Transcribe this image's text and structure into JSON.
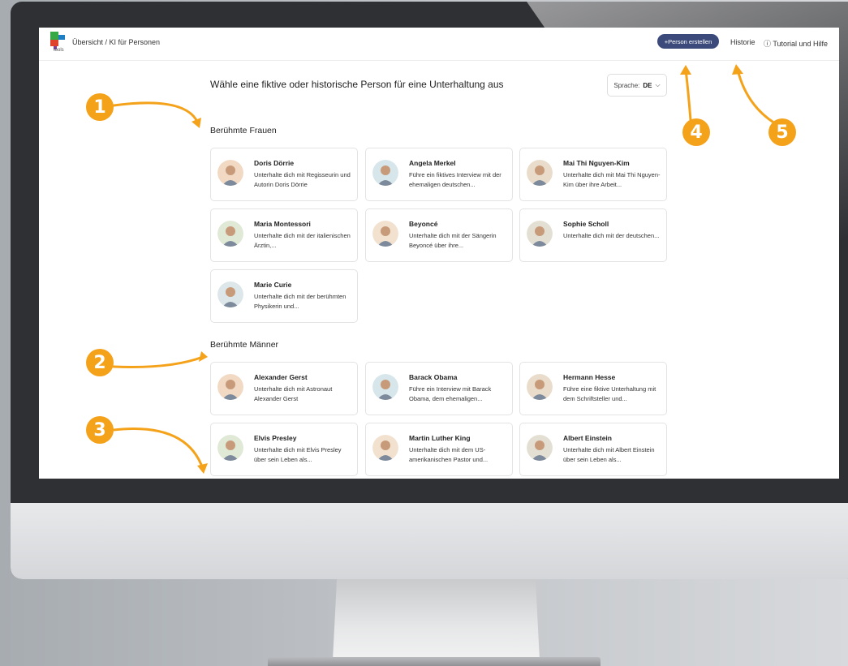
{
  "topbar": {
    "breadcrumb": "Übersicht / KI für Personen",
    "logo_text": "tools",
    "create_button": "+Person erstellen",
    "history_link": "Historie",
    "tutorial_link": "ⓘ Tutorial und Hilfe"
  },
  "main": {
    "headline": "Wähle eine fiktive oder historische Person für eine Unterhaltung aus",
    "language_label": "Sprache:",
    "language_value": "DE",
    "sections": [
      {
        "title": "Berühmte Frauen",
        "cards": [
          {
            "name": "Doris Dörrie",
            "desc": "Unterhalte dich mit Regisseurin und Autorin Doris Dörrie"
          },
          {
            "name": "Angela Merkel",
            "desc": "Führe ein fiktives Interview mit der ehemaligen deutschen..."
          },
          {
            "name": "Mai Thi Nguyen-Kim",
            "desc": "Unterhalte dich mit Mai Thi Nguyen-Kim über ihre Arbeit..."
          },
          {
            "name": "Maria Montessori",
            "desc": "Unterhalte dich mit der italienischen Ärztin,..."
          },
          {
            "name": "Beyoncé",
            "desc": "Unterhalte dich mit der Sängerin Beyoncé über ihre..."
          },
          {
            "name": "Sophie Scholl",
            "desc": "Unterhalte dich mit der deutschen..."
          },
          {
            "name": "Marie Curie",
            "desc": "Unterhalte dich mit der berühmten Physikerin und..."
          }
        ]
      },
      {
        "title": "Berühmte Männer",
        "cards": [
          {
            "name": "Alexander Gerst",
            "desc": "Unterhalte dich mit Astronaut Alexander Gerst"
          },
          {
            "name": "Barack Obama",
            "desc": "Führe ein Interview mit Barack Obama, dem ehemaligen..."
          },
          {
            "name": "Hermann Hesse",
            "desc": "Führe eine fiktive Unterhaltung mit dem Schriftsteller und..."
          },
          {
            "name": "Elvis Presley",
            "desc": "Unterhalte dich mit Elvis Presley über sein Leben als..."
          },
          {
            "name": "Martin Luther King",
            "desc": "Unterhalte dich mit dem US-amerikanischen Pastor und..."
          },
          {
            "name": "Albert Einstein",
            "desc": "Unterhalte dich mit Albert Einstein über sein Leben als..."
          }
        ]
      }
    ]
  },
  "annotations": [
    "1",
    "2",
    "3",
    "4",
    "5"
  ],
  "colors": {
    "badge": "#f5a21b",
    "primary_button": "#3b4a7a",
    "avatar_palette": [
      "#f1d9c4",
      "#d7e6ea",
      "#e9dccb",
      "#dfe9d6",
      "#f2e1cf",
      "#e4dfd3",
      "#dde6e8"
    ]
  }
}
